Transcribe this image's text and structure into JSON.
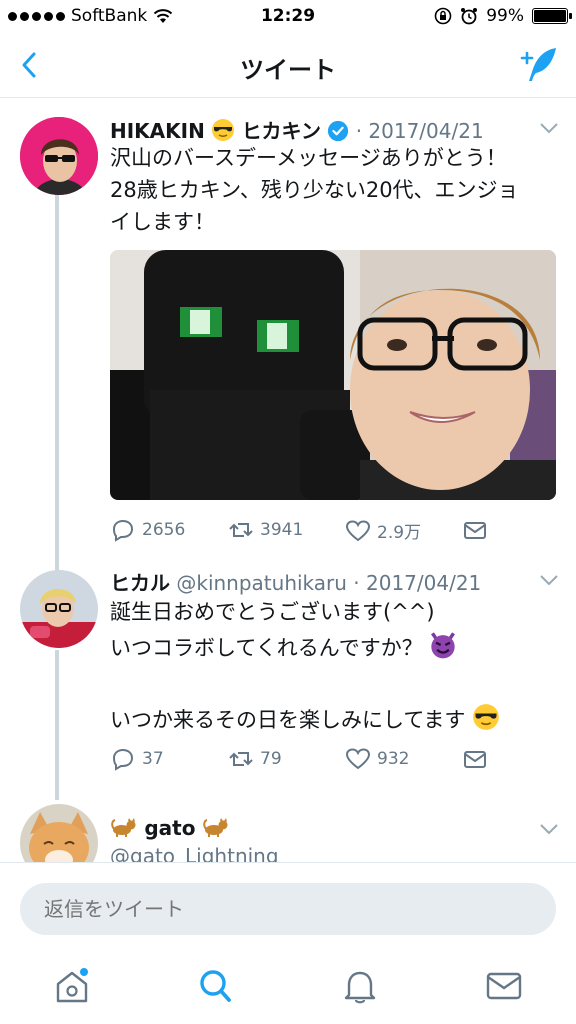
{
  "status": {
    "carrier": "SoftBank",
    "time": "12:29",
    "battery": "99%",
    "battery_level": 0.99
  },
  "nav": {
    "title": "ツイート",
    "back_icon": "chevron-left-icon",
    "compose_icon": "compose-tweet-icon"
  },
  "tweets": [
    {
      "name": "HIKAKIN",
      "name_suffix": "ヒカキン",
      "verified": true,
      "date": "· 2017/04/21",
      "text_lines": [
        "沢山のバースデーメッセージありがとう！",
        "28歳ヒカキン、残り少ない20代、エンジョ",
        "イします！"
      ],
      "has_media": true,
      "replies": "2656",
      "retweets": "3941",
      "likes": "2.9万"
    },
    {
      "name": "ヒカル",
      "handle": "@kinnpatuhikaru",
      "date": "· 2017/04/21",
      "text_lines": [
        "誕生日おめでとうございます(^^)",
        "いつコラボしてくれるんですか？",
        "",
        "いつか来るその日を楽しみにしてます"
      ],
      "replies": "37",
      "retweets": "79",
      "likes": "932"
    },
    {
      "name": "gato",
      "handle": "@gato_Lightning"
    }
  ],
  "reply": {
    "placeholder": "返信をツイート"
  },
  "tabs": [
    {
      "name": "home",
      "icon": "home-icon",
      "has_notification_dot": true
    },
    {
      "name": "search",
      "icon": "search-icon",
      "active": true
    },
    {
      "name": "notifications",
      "icon": "bell-icon"
    },
    {
      "name": "messages",
      "icon": "envelope-icon"
    }
  ],
  "colors": {
    "accent": "#1da1f2",
    "secondary_text": "#657786",
    "divider": "#e1e8ed",
    "input_bg": "#e6ecf0",
    "thread_line": "#ccd6dd"
  }
}
